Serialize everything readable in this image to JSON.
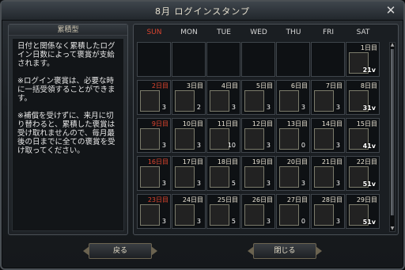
{
  "window": {
    "title": "8月 ログインスタンプ",
    "close_label": "✕"
  },
  "left_panel": {
    "header": "累積型",
    "paragraphs": [
      "日付と関係なく累積したログイン日数によって褒賞が支給されます。",
      "※ログイン褒賞は、必要な時に一括受領することができます。",
      "※補償を受けずに、来月に切り替わると、累積した褒賞は受け取れませんので、毎月最後の日までに全ての褒賞を受け取ってください。"
    ]
  },
  "calendar": {
    "weekdays": [
      "SUN",
      "MON",
      "TUE",
      "WED",
      "THU",
      "FRI",
      "SAT"
    ],
    "weekday_colors": {
      "sunday": "#d8442f",
      "normal": "#d6d6d6"
    },
    "rows": [
      [
        {
          "day": ""
        },
        {
          "day": ""
        },
        {
          "day": ""
        },
        {
          "day": ""
        },
        {
          "day": ""
        },
        {
          "day": ""
        },
        {
          "day": "1日目",
          "item": "box-gold",
          "badge": "21v"
        }
      ],
      [
        {
          "day": "2日目",
          "item": "potion-red",
          "count": "3"
        },
        {
          "day": "3日目",
          "item": "card",
          "count": "2"
        },
        {
          "day": "4日目",
          "item": "vial-purple",
          "count": "3"
        },
        {
          "day": "5日目",
          "item": "vial-pink",
          "count": "3"
        },
        {
          "day": "6日目",
          "item": "vial-red",
          "count": "3"
        },
        {
          "day": "7日目",
          "item": "scroll-blue",
          "count": "3"
        },
        {
          "day": "8日目",
          "item": "box-gold",
          "badge": "31v"
        }
      ],
      [
        {
          "day": "9日目",
          "item": "potion-red",
          "count": "3"
        },
        {
          "day": "10日目",
          "item": "card",
          "count": "3"
        },
        {
          "day": "11日目",
          "item": "vial-purple",
          "count": "10"
        },
        {
          "day": "12日目",
          "item": "vial-pink",
          "count": "3"
        },
        {
          "day": "13日目",
          "item": "vial-red",
          "count": "0"
        },
        {
          "day": "14日目",
          "item": "scroll-blue",
          "count": "3"
        },
        {
          "day": "15日目",
          "item": "box-gold",
          "badge": "41v"
        }
      ],
      [
        {
          "day": "16日目",
          "item": "potion-red",
          "count": "3"
        },
        {
          "day": "17日目",
          "item": "card",
          "count": "3"
        },
        {
          "day": "18日目",
          "item": "vial-purple",
          "count": "5"
        },
        {
          "day": "19日目",
          "item": "vial-pink",
          "count": "3"
        },
        {
          "day": "20日目",
          "item": "vial-red",
          "count": "3"
        },
        {
          "day": "21日目",
          "item": "scroll-blue",
          "count": "3"
        },
        {
          "day": "22日目",
          "item": "box-gold",
          "badge": "51v"
        }
      ],
      [
        {
          "day": "23日目",
          "item": "potion-red",
          "count": "3"
        },
        {
          "day": "24日目",
          "item": "card",
          "count": "3"
        },
        {
          "day": "25日目",
          "item": "vial-purple",
          "count": "5"
        },
        {
          "day": "26日目",
          "item": "vial-pink",
          "count": "3"
        },
        {
          "day": "27日目",
          "item": "vial-red",
          "count": "0"
        },
        {
          "day": "28日目",
          "item": "scroll-blue",
          "count": "3"
        },
        {
          "day": "29日目",
          "item": "box-gold",
          "badge": "51v"
        }
      ]
    ]
  },
  "footer": {
    "back_label": "戻る",
    "close_label": "閉じる"
  }
}
